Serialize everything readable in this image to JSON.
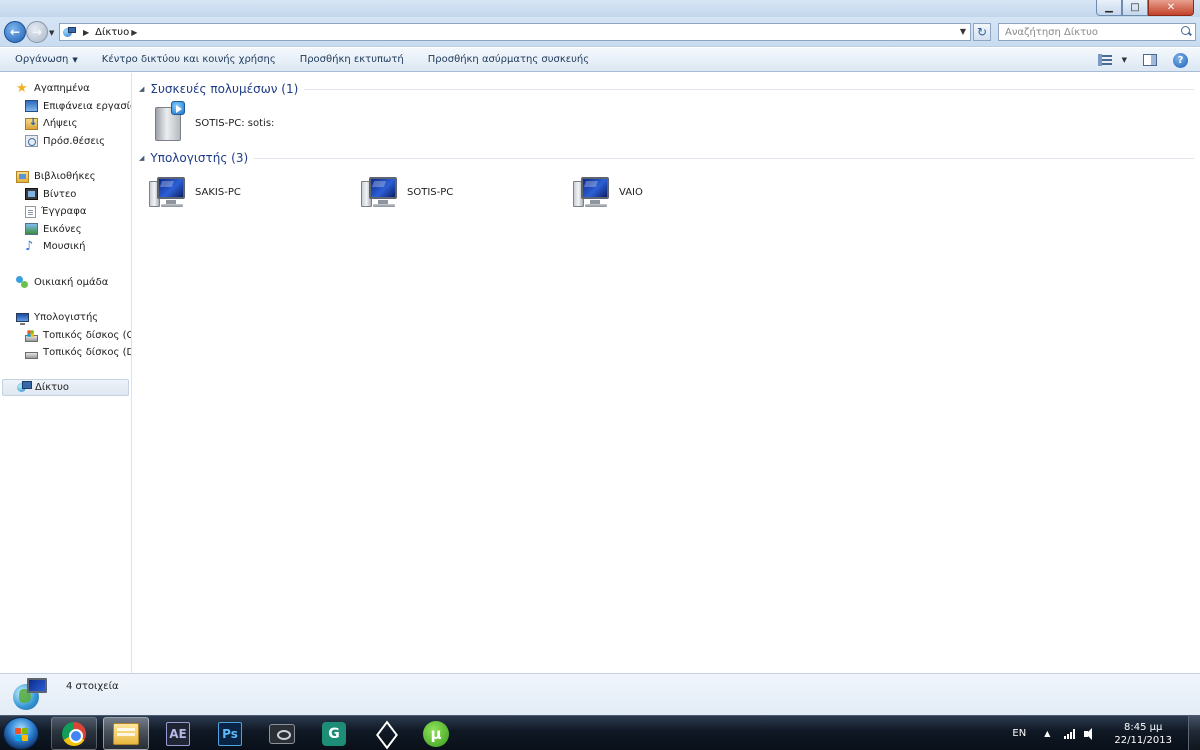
{
  "window": {
    "title": "Δίκτυο",
    "controls": {
      "minimize": "▁",
      "maximize": "□",
      "close": "✕"
    }
  },
  "address": {
    "breadcrumb": [
      "Δίκτυο"
    ],
    "search_placeholder": "Αναζήτηση Δίκτυο"
  },
  "toolbar": {
    "organize": "Οργάνωση",
    "network_center": "Κέντρο δικτύου και κοινής χρήσης",
    "add_printer": "Προσθήκη εκτυπωτή",
    "add_wireless": "Προσθήκη ασύρματης συσκευής"
  },
  "nav": {
    "favorites": {
      "label": "Αγαπημένα",
      "items": [
        "Επιφάνεια εργασίας",
        "Λήψεις",
        "Πρόσ.θέσεις"
      ]
    },
    "libraries": {
      "label": "Βιβλιοθήκες",
      "items": [
        "Βίντεο",
        "Έγγραφα",
        "Εικόνες",
        "Μουσική"
      ]
    },
    "homegroup": "Οικιακή ομάδα",
    "computer": {
      "label": "Υπολογιστής",
      "items": [
        "Τοπικός δίσκος (C:)",
        "Τοπικός δίσκος (D:)"
      ]
    },
    "network": "Δίκτυο"
  },
  "content": {
    "media_group": {
      "title": "Συσκευές πολυμέσων (1)",
      "items": [
        "SOTIS-PC: sotis:"
      ]
    },
    "computers_group": {
      "title": "Υπολογιστής (3)",
      "items": [
        "SAKIS-PC",
        "SOTIS-PC",
        "VAIO"
      ]
    }
  },
  "details": {
    "item_count": "4 στοιχεία"
  },
  "taskbar": {
    "apps": [
      "chrome-icon",
      "explorer-icon",
      "after-effects-icon",
      "photoshop-icon",
      "media-app-icon",
      "sixgen-icon",
      "unity-icon",
      "utorrent-icon"
    ],
    "ae_label": "AE",
    "ps_label": "Ps",
    "sixgen_label": "G",
    "utorrent_label": "µ",
    "language": "EN",
    "time": "8:45 μμ",
    "date": "22/11/2013"
  }
}
